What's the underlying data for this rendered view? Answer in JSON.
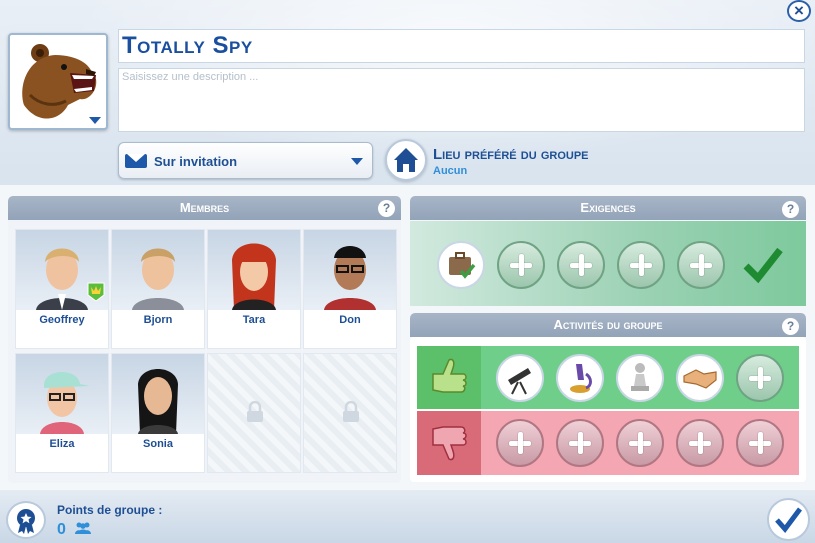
{
  "header": {
    "group_name": "Totally Spy",
    "description_placeholder": "Saisissez une description ...",
    "close_label": "×"
  },
  "membership": {
    "selected": "Sur invitation"
  },
  "favorite_place": {
    "title": "Lieu préféré du groupe",
    "value": "Aucun"
  },
  "members_panel": {
    "title": "Membres",
    "help": "?",
    "members": [
      {
        "name": "Geoffrey"
      },
      {
        "name": "Bjorn"
      },
      {
        "name": "Tara"
      },
      {
        "name": "Don"
      },
      {
        "name": "Eliza"
      },
      {
        "name": "Sonia"
      }
    ]
  },
  "requirements_panel": {
    "title": "Exigences",
    "help": "?"
  },
  "activities_panel": {
    "title": "Activités du groupe",
    "help": "?"
  },
  "footer": {
    "points_label": "Points de groupe :",
    "points_value": "0"
  },
  "colors": {
    "accent": "#1e4f94",
    "light_accent": "#2f8fd8",
    "likes": "#6fcf8a",
    "dislikes": "#f4a7b3",
    "requirements": "#9ad1b3"
  }
}
